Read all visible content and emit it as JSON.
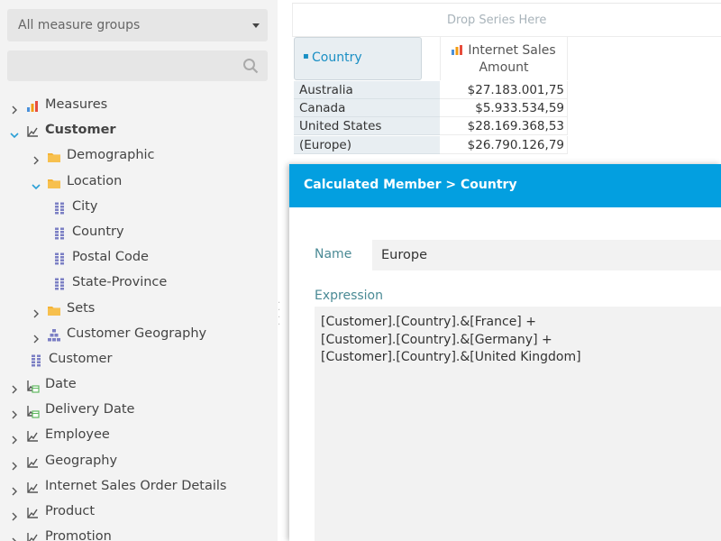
{
  "sidebar": {
    "measure_group_select": "All measure groups",
    "search_placeholder": "",
    "tree": [
      {
        "label": "Measures",
        "icon": "bar-chart-icon",
        "level": 0,
        "expanded": false,
        "bold": false
      },
      {
        "label": "Customer",
        "icon": "dimension-icon",
        "level": 0,
        "expanded": true,
        "bold": true
      },
      {
        "label": "Demographic",
        "icon": "folder-icon",
        "level": 1,
        "expanded": false,
        "bold": false
      },
      {
        "label": "Location",
        "icon": "folder-icon",
        "level": 1,
        "expanded": true,
        "bold": false
      },
      {
        "label": "City",
        "icon": "attribute-icon",
        "level": 2,
        "bold": false
      },
      {
        "label": "Country",
        "icon": "attribute-icon",
        "level": 2,
        "bold": false
      },
      {
        "label": "Postal Code",
        "icon": "attribute-icon",
        "level": 2,
        "bold": false
      },
      {
        "label": "State-Province",
        "icon": "attribute-icon",
        "level": 2,
        "bold": false
      },
      {
        "label": "Sets",
        "icon": "folder-icon",
        "level": 1,
        "expanded": false,
        "bold": false
      },
      {
        "label": "Customer Geography",
        "icon": "hierarchy-icon",
        "level": 1,
        "expanded": false,
        "bold": false
      },
      {
        "label": "Customer",
        "icon": "attribute-icon",
        "level": 1,
        "bold": false
      },
      {
        "label": "Date",
        "icon": "time-dimension-icon",
        "level": 0,
        "expanded": false,
        "bold": false
      },
      {
        "label": "Delivery Date",
        "icon": "time-dimension-icon",
        "level": 0,
        "expanded": false,
        "bold": false
      },
      {
        "label": "Employee",
        "icon": "dimension-icon",
        "level": 0,
        "expanded": false,
        "bold": false
      },
      {
        "label": "Geography",
        "icon": "dimension-icon",
        "level": 0,
        "expanded": false,
        "bold": false
      },
      {
        "label": "Internet Sales Order Details",
        "icon": "dimension-icon",
        "level": 0,
        "expanded": false,
        "bold": false
      },
      {
        "label": "Product",
        "icon": "dimension-icon",
        "level": 0,
        "expanded": false,
        "bold": false
      },
      {
        "label": "Promotion",
        "icon": "dimension-icon",
        "level": 0,
        "expanded": false,
        "bold": false
      }
    ]
  },
  "pivot": {
    "drop_series": "Drop Series Here",
    "row_header": "Country",
    "column_header_line1": "Internet Sales",
    "column_header_line2": "Amount",
    "rows": [
      {
        "country": "Australia",
        "value": "$27.183.001,75"
      },
      {
        "country": "Canada",
        "value": "$5.933.534,59"
      },
      {
        "country": "United States",
        "value": "$28.169.368,53"
      },
      {
        "country": "(Europe)",
        "value": "$26.790.126,79"
      }
    ]
  },
  "dialog": {
    "title": "Calculated Member > Country",
    "name_label": "Name",
    "name_value": "Europe",
    "expression_label": "Expression",
    "expression_lines": [
      "[Customer].[Country].&[France] +",
      "[Customer].[Country].&[Germany] +",
      "[Customer].[Country].&[United Kingdom]"
    ]
  },
  "colors": {
    "accent": "#039fe0",
    "label_teal": "#4a8a95",
    "folder": "#f5b335",
    "attribute": "#7b7fc4"
  }
}
